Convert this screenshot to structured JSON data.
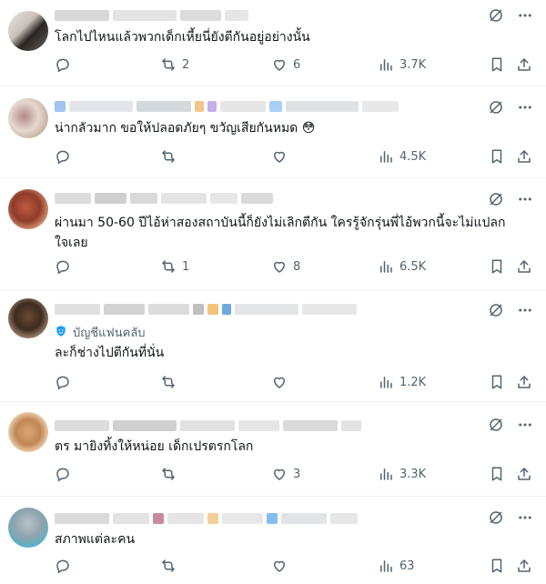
{
  "icons": {
    "mute": "slashed-circle-icon",
    "more": "more-dots-icon",
    "reply": "reply-bubble-icon",
    "retweet": "retweet-icon",
    "like": "heart-icon",
    "views": "views-bars-icon",
    "bookmark": "bookmark-icon",
    "share": "share-upload-icon",
    "fan_badge": "shield-badge-icon"
  },
  "colors": {
    "text": "#0f1419",
    "muted": "#536471",
    "divider": "#eff3f4"
  },
  "replies": [
    {
      "text": "โลกไปไหนแล้วพวกเด็กเหี้ยนี่ยังตีกันอยู่อย่างนั้น",
      "retweets": "2",
      "likes": "6",
      "views": "3.7K"
    },
    {
      "text": "น่ากลัวมาก ขอให้ปลอดภัยๆ ขวัญเสียกันหมด 😳",
      "retweets": "",
      "likes": "",
      "views": "4.5K"
    },
    {
      "text": "ผ่านมา 50-60 ปีไอ้ห่าสองสถาบันนี้ก็ยังไม่เลิกตีกัน ใครรู้จักรุ่นพี่ไอ้พวกนี้จะไม่แปลกใจเลย",
      "retweets": "1",
      "likes": "8",
      "views": "6.5K"
    },
    {
      "fan_label": "บัญชีแฟนคลับ",
      "text": "ละก็ช่างไปตีกันที่นั่น",
      "retweets": "",
      "likes": "",
      "views": "1.2K"
    },
    {
      "text": "ตร มายิงทิ้งให้หน่อย เด็กเปรตรกโลก",
      "retweets": "",
      "likes": "3",
      "views": "3.3K"
    },
    {
      "text": "สภาพแต่ละคน",
      "retweets": "",
      "likes": "",
      "views": "63"
    }
  ]
}
